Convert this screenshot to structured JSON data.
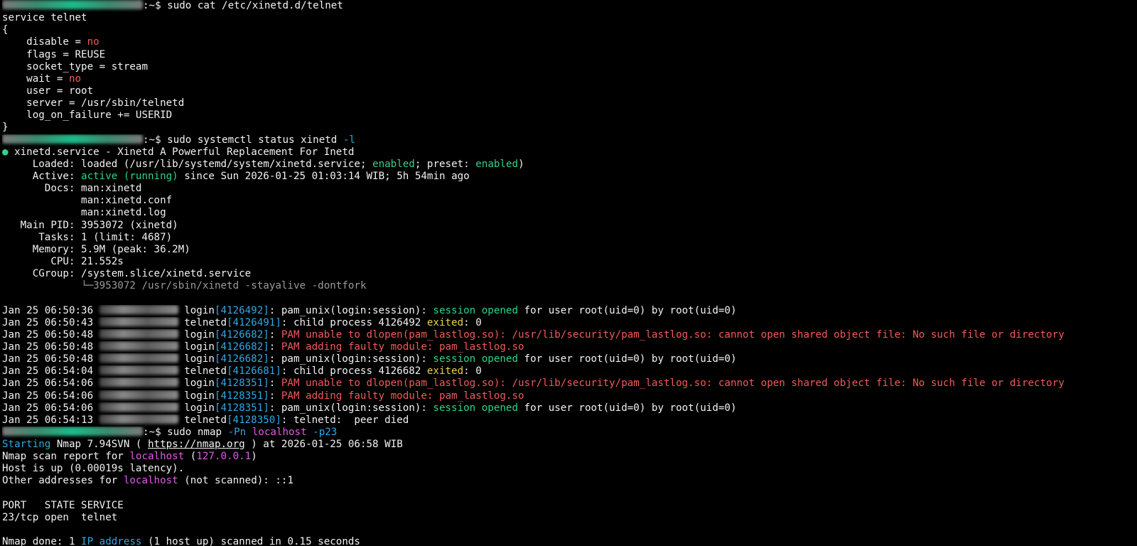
{
  "colors": {
    "default": "#f2f2f2",
    "red": "#f15a5a",
    "green": "#2fd38a",
    "cyan": "#30a8e0",
    "magenta": "#e05ae8",
    "yellow": "#e8d34a",
    "dim": "#9a9a9a",
    "white": "#ffffff"
  },
  "blur_widths": {
    "host": 198,
    "log": 111
  },
  "lines": [
    [
      {
        "b": "host"
      },
      {
        "t": ":~$ sudo cat /etc/xinetd.d/telnet"
      }
    ],
    [
      {
        "t": "service telnet"
      }
    ],
    [
      {
        "t": "{"
      }
    ],
    [
      {
        "t": "    disable = "
      },
      {
        "t": "no",
        "c": "red"
      }
    ],
    [
      {
        "t": "    flags = REUSE"
      }
    ],
    [
      {
        "t": "    socket_type = stream"
      }
    ],
    [
      {
        "t": "    wait = "
      },
      {
        "t": "no",
        "c": "red"
      }
    ],
    [
      {
        "t": "    user = root"
      }
    ],
    [
      {
        "t": "    server = /usr/sbin/telnetd"
      }
    ],
    [
      {
        "t": "    log_on_failure += USERID"
      }
    ],
    [
      {
        "t": "}"
      }
    ],
    [
      {
        "b": "host"
      },
      {
        "t": ":~$ sudo systemctl status xinetd "
      },
      {
        "t": "-l",
        "c": "cyan"
      }
    ],
    [
      {
        "t": "●",
        "c": "green"
      },
      {
        "t": " xinetd.service - Xinetd A Powerful Replacement For Inetd"
      }
    ],
    [
      {
        "t": "     Loaded: loaded (/usr/lib/systemd/system/xinetd.service; "
      },
      {
        "t": "enabled",
        "c": "green"
      },
      {
        "t": "; preset: "
      },
      {
        "t": "enabled",
        "c": "green"
      },
      {
        "t": ")"
      }
    ],
    [
      {
        "t": "     Active: "
      },
      {
        "t": "active (running)",
        "c": "green"
      },
      {
        "t": " since Sun 2026-01-25 01:03:14 WIB; 5h 54min ago"
      }
    ],
    [
      {
        "t": "       Docs: man:xinetd"
      }
    ],
    [
      {
        "t": "             man:xinetd.conf"
      }
    ],
    [
      {
        "t": "             man:xinetd.log"
      }
    ],
    [
      {
        "t": "   Main PID: 3953072 (xinetd)"
      }
    ],
    [
      {
        "t": "      Tasks: 1 (limit: 4687)"
      }
    ],
    [
      {
        "t": "     Memory: 5.9M (peak: 36.2M)"
      }
    ],
    [
      {
        "t": "        CPU: 21.552s"
      }
    ],
    [
      {
        "t": "     CGroup: /system.slice/xinetd.service"
      }
    ],
    [
      {
        "t": "             └─",
        "c": "dim"
      },
      {
        "t": "3953072 /usr/sbin/xinetd -stayalive -dontfork",
        "c": "dim"
      }
    ],
    [
      {
        "t": ""
      }
    ],
    [
      {
        "t": "Jan 25 06:50:36 "
      },
      {
        "b": "log"
      },
      {
        "t": " login"
      },
      {
        "t": "[4126492]",
        "c": "cyan"
      },
      {
        "t": ": pam_unix(login:session): "
      },
      {
        "t": "session opened",
        "c": "green"
      },
      {
        "t": " for user root(uid=0) by root(uid=0)"
      }
    ],
    [
      {
        "t": "Jan 25 06:50:43 "
      },
      {
        "b": "log"
      },
      {
        "t": " telnetd"
      },
      {
        "t": "[4126491]",
        "c": "cyan"
      },
      {
        "t": ": child process 4126492 "
      },
      {
        "t": "exited",
        "c": "yellow"
      },
      {
        "t": ": 0"
      }
    ],
    [
      {
        "t": "Jan 25 06:50:48 "
      },
      {
        "b": "log"
      },
      {
        "t": " login"
      },
      {
        "t": "[4126682]",
        "c": "cyan"
      },
      {
        "t": ": "
      },
      {
        "t": "PAM unable to dlopen(pam_lastlog.so): /usr/lib/security/pam_lastlog.so: cannot open shared object file: No such file or directory",
        "c": "red"
      }
    ],
    [
      {
        "t": "Jan 25 06:50:48 "
      },
      {
        "b": "log"
      },
      {
        "t": " login"
      },
      {
        "t": "[4126682]",
        "c": "cyan"
      },
      {
        "t": ": "
      },
      {
        "t": "PAM adding faulty module: pam_lastlog.so",
        "c": "red"
      }
    ],
    [
      {
        "t": "Jan 25 06:50:48 "
      },
      {
        "b": "log"
      },
      {
        "t": " login"
      },
      {
        "t": "[4126682]",
        "c": "cyan"
      },
      {
        "t": ": pam_unix(login:session): "
      },
      {
        "t": "session opened",
        "c": "green"
      },
      {
        "t": " for user root(uid=0) by root(uid=0)"
      }
    ],
    [
      {
        "t": "Jan 25 06:54:04 "
      },
      {
        "b": "log"
      },
      {
        "t": " telnetd"
      },
      {
        "t": "[4126681]",
        "c": "cyan"
      },
      {
        "t": ": child process 4126682 "
      },
      {
        "t": "exited",
        "c": "yellow"
      },
      {
        "t": ": 0"
      }
    ],
    [
      {
        "t": "Jan 25 06:54:06 "
      },
      {
        "b": "log"
      },
      {
        "t": " login"
      },
      {
        "t": "[4128351]",
        "c": "cyan"
      },
      {
        "t": ": "
      },
      {
        "t": "PAM unable to dlopen(pam_lastlog.so): /usr/lib/security/pam_lastlog.so: cannot open shared object file: No such file or directory",
        "c": "red"
      }
    ],
    [
      {
        "t": "Jan 25 06:54:06 "
      },
      {
        "b": "log"
      },
      {
        "t": " login"
      },
      {
        "t": "[4128351]",
        "c": "cyan"
      },
      {
        "t": ": "
      },
      {
        "t": "PAM adding faulty module: pam_lastlog.so",
        "c": "red"
      }
    ],
    [
      {
        "t": "Jan 25 06:54:06 "
      },
      {
        "b": "log"
      },
      {
        "t": " login"
      },
      {
        "t": "[4128351]",
        "c": "cyan"
      },
      {
        "t": ": pam_unix(login:session): "
      },
      {
        "t": "session opened",
        "c": "green"
      },
      {
        "t": " for user root(uid=0) by root(uid=0)"
      }
    ],
    [
      {
        "t": "Jan 25 06:54:13 "
      },
      {
        "b": "log"
      },
      {
        "t": " telnetd"
      },
      {
        "t": "[4128350]",
        "c": "cyan"
      },
      {
        "t": ": telnetd:  peer died"
      }
    ],
    [
      {
        "b": "host"
      },
      {
        "t": ":~$ sudo nmap "
      },
      {
        "t": "-Pn",
        "c": "cyan"
      },
      {
        "t": " "
      },
      {
        "t": "localhost",
        "c": "magenta"
      },
      {
        "t": " "
      },
      {
        "t": "-p23",
        "c": "cyan"
      }
    ],
    [
      {
        "t": "Starting",
        "c": "cyan"
      },
      {
        "t": " Nmap 7.94SVN ( "
      },
      {
        "t": "https://nmap.org",
        "u": true
      },
      {
        "t": " ) at 2026-01-25 06:58 WIB"
      }
    ],
    [
      {
        "t": "Nmap scan report for "
      },
      {
        "t": "localhost",
        "c": "magenta"
      },
      {
        "t": " ("
      },
      {
        "t": "127.0.0.1",
        "c": "magenta"
      },
      {
        "t": ")"
      }
    ],
    [
      {
        "t": "Host is up (0.00019s latency)."
      }
    ],
    [
      {
        "t": "Other addresses for "
      },
      {
        "t": "localhost",
        "c": "magenta"
      },
      {
        "t": " (not scanned): ::1"
      }
    ],
    [
      {
        "t": ""
      }
    ],
    [
      {
        "t": "PORT   STATE SERVICE"
      }
    ],
    [
      {
        "t": "23/tcp open  telnet"
      }
    ],
    [
      {
        "t": ""
      }
    ],
    [
      {
        "t": "Nmap done: 1 "
      },
      {
        "t": "IP address",
        "c": "cyan"
      },
      {
        "t": " (1 host up) scanned in 0.15 seconds"
      }
    ]
  ]
}
